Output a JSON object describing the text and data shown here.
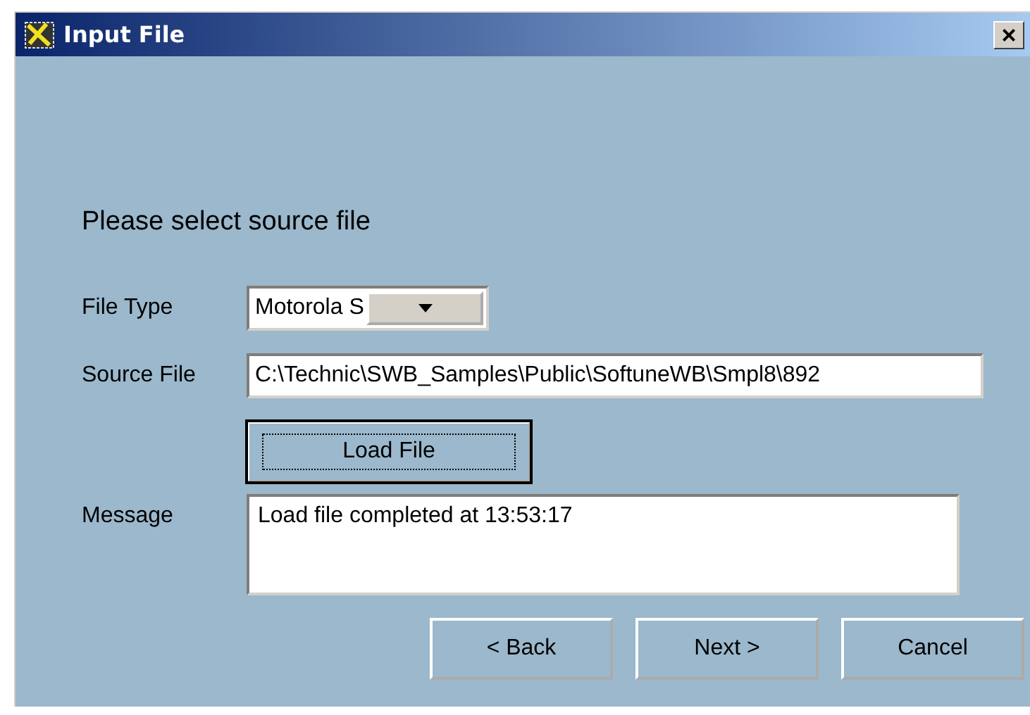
{
  "window": {
    "title": "Input File",
    "close": "×"
  },
  "heading": "Please select source file",
  "file_type": {
    "label": "File Type",
    "value": "Motorola S"
  },
  "source_file": {
    "label": "Source File",
    "value": "C:\\Technic\\SWB_Samples\\Public\\SoftuneWB\\Smpl8\\892"
  },
  "load_button": {
    "label": "Load File",
    "focused": true
  },
  "message": {
    "label": "Message",
    "value": "Load file completed at 13:53:17"
  },
  "buttons": [
    {
      "label": "< Back"
    },
    {
      "label": "Next >"
    },
    {
      "label": "Cancel"
    }
  ]
}
